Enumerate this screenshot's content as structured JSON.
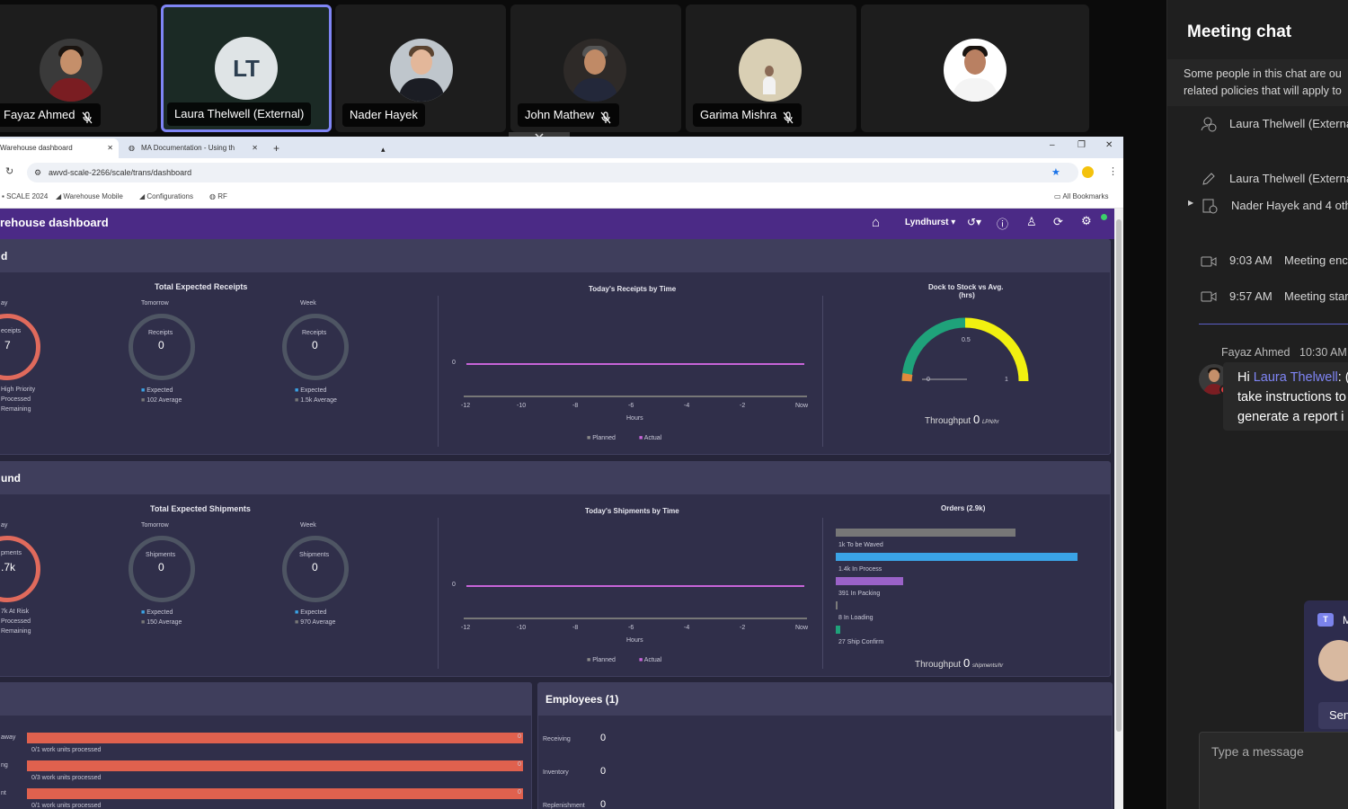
{
  "participants": [
    {
      "name": "Fayaz Ahmed",
      "muted": true
    },
    {
      "name": "Laura Thelwell (External)",
      "initials": "LT",
      "muted": false,
      "active": true
    },
    {
      "name": "Nader Hayek",
      "muted": false
    },
    {
      "name": "John Mathew",
      "muted": true
    },
    {
      "name": "Garima Mishra",
      "muted": true
    },
    {
      "name": "",
      "muted": false
    }
  ],
  "browser": {
    "tabs": [
      "Warehouse dashboard",
      "MA Documentation - Using th"
    ],
    "new_tab": "+",
    "url": "awvd-scale-2266/scale/trans/dashboard",
    "bookmarks": [
      "SCALE 2024",
      "Warehouse Mobile",
      "Configurations",
      "RF"
    ],
    "all_bookmarks": "All Bookmarks",
    "window_controls": [
      "–",
      "❐",
      "✕"
    ]
  },
  "app": {
    "title": "rehouse dashboard",
    "location": "Lyndhurst",
    "inbound": {
      "header": "d",
      "receipts_title": "Total Expected Receipts",
      "today": {
        "col": "ay",
        "ring_label": "eceipts",
        "value": "7",
        "legend": [
          "High Priority",
          "Processed",
          "Remaining"
        ]
      },
      "tomorrow": {
        "col": "Tomorrow",
        "ring_label": "Receipts",
        "value": "0",
        "legend": [
          "Expected",
          "102 Average"
        ]
      },
      "week": {
        "col": "Week",
        "ring_label": "Receipts",
        "value": "0",
        "legend": [
          "Expected",
          "1.5k Average"
        ]
      },
      "chart_title": "Today's Receipts by Time",
      "x_ticks": [
        "-12",
        "-10",
        "-8",
        "-6",
        "-4",
        "-2",
        "Now"
      ],
      "x_label": "Hours",
      "y_tick": "0",
      "legend": [
        "Planned",
        "Actual"
      ],
      "gauge_title": "Dock to Stock vs Avg.",
      "gauge_sub": "(hrs)",
      "gauge_ticks": [
        "0",
        "0.5",
        "1"
      ],
      "throughput_label": "Throughput",
      "throughput_value": "0",
      "throughput_unit": "LPN/hr"
    },
    "outbound": {
      "header": "und",
      "shipments_title": "Total Expected Shipments",
      "today": {
        "col": "ay",
        "ring_label": "pments",
        "value": ".7k",
        "legend": [
          "7k At Risk",
          "Processed",
          "Remaining"
        ]
      },
      "tomorrow": {
        "col": "Tomorrow",
        "ring_label": "Shipments",
        "value": "0",
        "legend": [
          "Expected",
          "150 Average"
        ]
      },
      "week": {
        "col": "Week",
        "ring_label": "Shipments",
        "value": "0",
        "legend": [
          "Expected",
          "970 Average"
        ]
      },
      "chart_title": "Today's Shipments by Time",
      "x_ticks": [
        "-12",
        "-10",
        "-8",
        "-6",
        "-4",
        "-2",
        "Now"
      ],
      "x_label": "Hours",
      "y_tick": "0",
      "legend": [
        "Planned",
        "Actual"
      ],
      "orders_title": "Orders (2.9k)",
      "orders": [
        "1k To be Waved",
        "1.4k In Process",
        "391 In Packing",
        "8 In Loading",
        "27 Ship Confirm"
      ],
      "throughput_label": "Throughput",
      "throughput_value": "0",
      "throughput_unit": "shipments/hr"
    },
    "work": {
      "rows": [
        {
          "label": "away",
          "text": "0/1 work units processed",
          "value": "0"
        },
        {
          "label": "ng",
          "text": "0/3 work units processed",
          "value": "0"
        },
        {
          "label": "nt",
          "text": "0/1 work units processed",
          "value": "0"
        }
      ]
    },
    "employees": {
      "header": "Employees (1)",
      "rows": [
        {
          "label": "Receiving",
          "value": "0"
        },
        {
          "label": "Inventory",
          "value": "0"
        },
        {
          "label": "Replenishment",
          "value": "0"
        }
      ]
    }
  },
  "chat": {
    "title": "Meeting chat",
    "notice1": "Some people in this chat are ou",
    "notice2": "related policies that will apply to",
    "events": [
      {
        "text": "Laura Thelwell (Externa"
      },
      {
        "text": "Laura Thelwell (Externa"
      },
      {
        "text": "Nader Hayek and 4 oth"
      },
      {
        "time": "9:03 AM",
        "text": "Meeting enc"
      },
      {
        "time": "9:57 AM",
        "text": "Meeting star"
      }
    ],
    "message": {
      "sender": "Fayaz Ahmed",
      "time": "10:30 AM",
      "line1_prefix": "Hi ",
      "mention": "Laura Thelwell",
      "line1_suffix": ": (",
      "line2": "take instructions to",
      "line3": "generate a report i"
    },
    "toast_button": "Sen",
    "toast_prefix": "M",
    "compose_placeholder": "Type a message"
  }
}
